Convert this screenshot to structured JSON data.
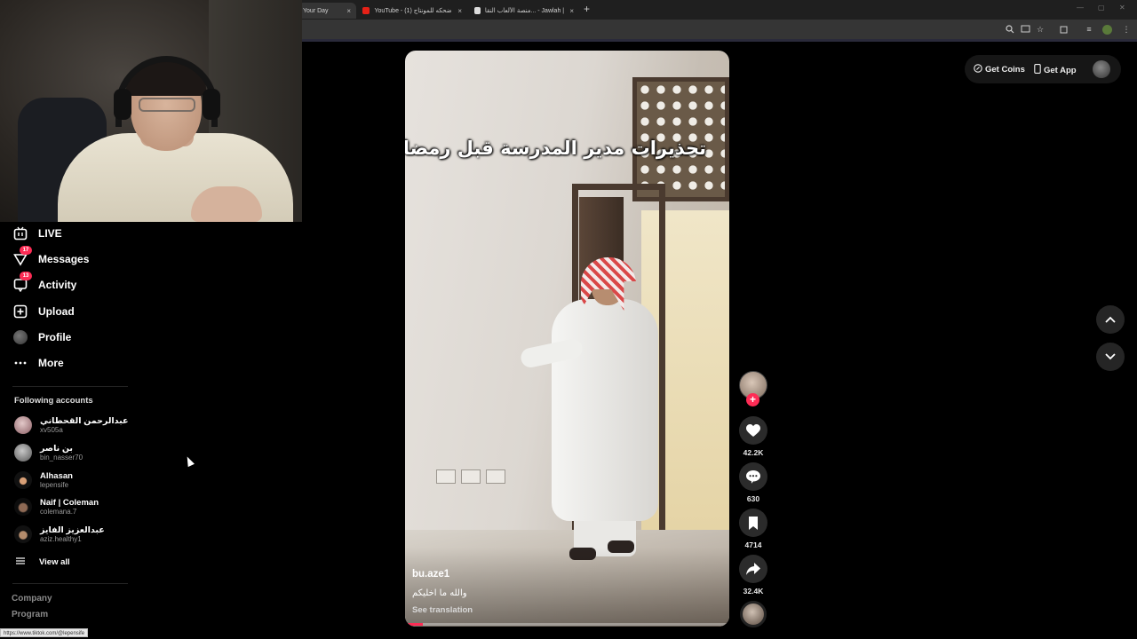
{
  "browser": {
    "tabs": [
      {
        "title": "Your Day",
        "close": "×"
      },
      {
        "title": "YouTube - صوت ضحكه للمونتاج (1)",
        "close": "×"
      },
      {
        "title": "منصة الألعاب النقا... - Jawlah | جولة",
        "close": "×"
      }
    ],
    "new_tab": "+",
    "status_url": "https://www.tiktok.com/@lepensife"
  },
  "sidebar": {
    "nav": [
      {
        "label": "LIVE",
        "icon": "live-tv-icon",
        "badge": ""
      },
      {
        "label": "Messages",
        "icon": "messages-icon",
        "badge": "17"
      },
      {
        "label": "Activity",
        "icon": "activity-icon",
        "badge": "13"
      },
      {
        "label": "Upload",
        "icon": "upload-icon",
        "badge": ""
      },
      {
        "label": "Profile",
        "icon": "profile-avatar-icon",
        "badge": ""
      },
      {
        "label": "More",
        "icon": "more-dots-icon",
        "badge": ""
      }
    ],
    "following_title": "Following accounts",
    "accounts": [
      {
        "name": "عبدالرحمن القحطاني",
        "username": "xv505a"
      },
      {
        "name": "بن ناصر",
        "username": "bin_nasser70"
      },
      {
        "name": "Alhasan",
        "username": "lepensife"
      },
      {
        "name": "Naif | Coleman",
        "username": "colemana.7"
      },
      {
        "name": "عبدالعزيز الفايز",
        "username": "aziz.healthy1"
      }
    ],
    "view_all": "View all",
    "footer": [
      "Company",
      "Program"
    ]
  },
  "video": {
    "caption_overlay": "تحذيرات مدير المدرسة قبل رمضان :",
    "username": "bu.aze1",
    "description": "والله ما اخليكم",
    "see_translation": "See translation",
    "progress": 0.055
  },
  "actions": {
    "likes": "42.2K",
    "comments": "630",
    "saves": "4714",
    "shares": "32.4K"
  },
  "topbar": {
    "get_coins": "Get Coins",
    "get_app": "Get App"
  },
  "colors": {
    "accent": "#fe2c55",
    "background": "#000000"
  }
}
